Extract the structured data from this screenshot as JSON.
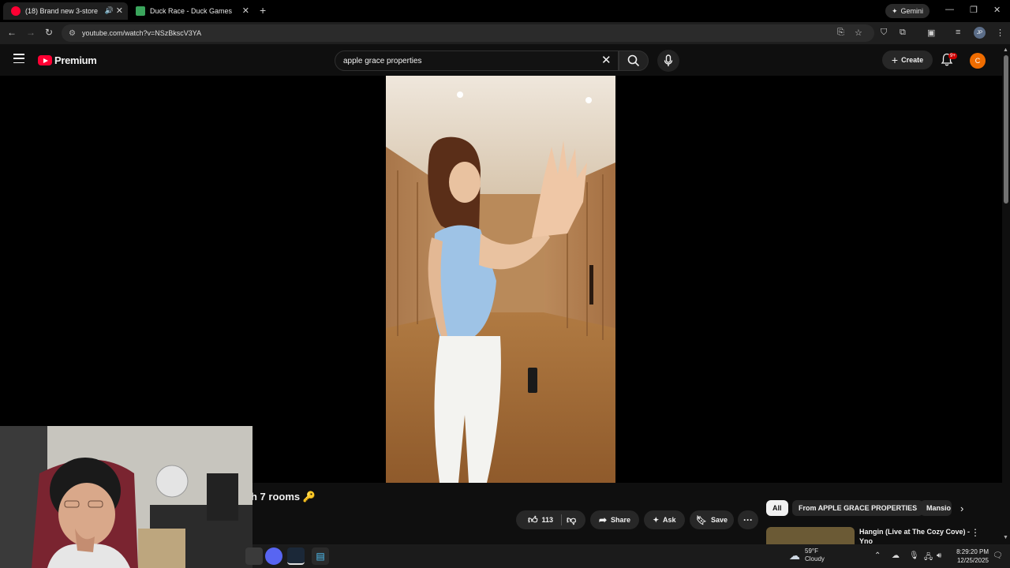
{
  "browser": {
    "tabs": [
      {
        "title": "(18) Brand new 3-storey",
        "active": true
      },
      {
        "title": "Duck Race - Duck Games",
        "active": false
      }
    ],
    "new_tab": "+",
    "gemini_label": "Gemini",
    "url": "youtube.com/watch?v=NSzBkscV3YA",
    "profile_initials": "JP"
  },
  "youtube": {
    "logo_text": "Premium",
    "search_query": "apple grace properties",
    "create_label": "Create",
    "notification_badge": "9+",
    "avatar_initial": "C"
  },
  "video": {
    "title_visible": "h 7 rooms 🔑",
    "likes": "113",
    "share_label": "Share",
    "ask_label": "Ask",
    "save_label": "Save"
  },
  "sidebar": {
    "chips": [
      "All",
      "From APPLE GRACE PROPERTIES",
      "Mansio"
    ],
    "recommendation_title": "Hangin (Live at The Cozy Cove) - Yno"
  },
  "taskbar": {
    "weather_temp": "59°F",
    "weather_desc": "Cloudy",
    "time": "8:29:20 PM",
    "date": "12/25/2025"
  },
  "colors": {
    "brand_red": "#ff0033",
    "background": "#0f0f0f",
    "avatar_orange": "#ef6c00"
  }
}
